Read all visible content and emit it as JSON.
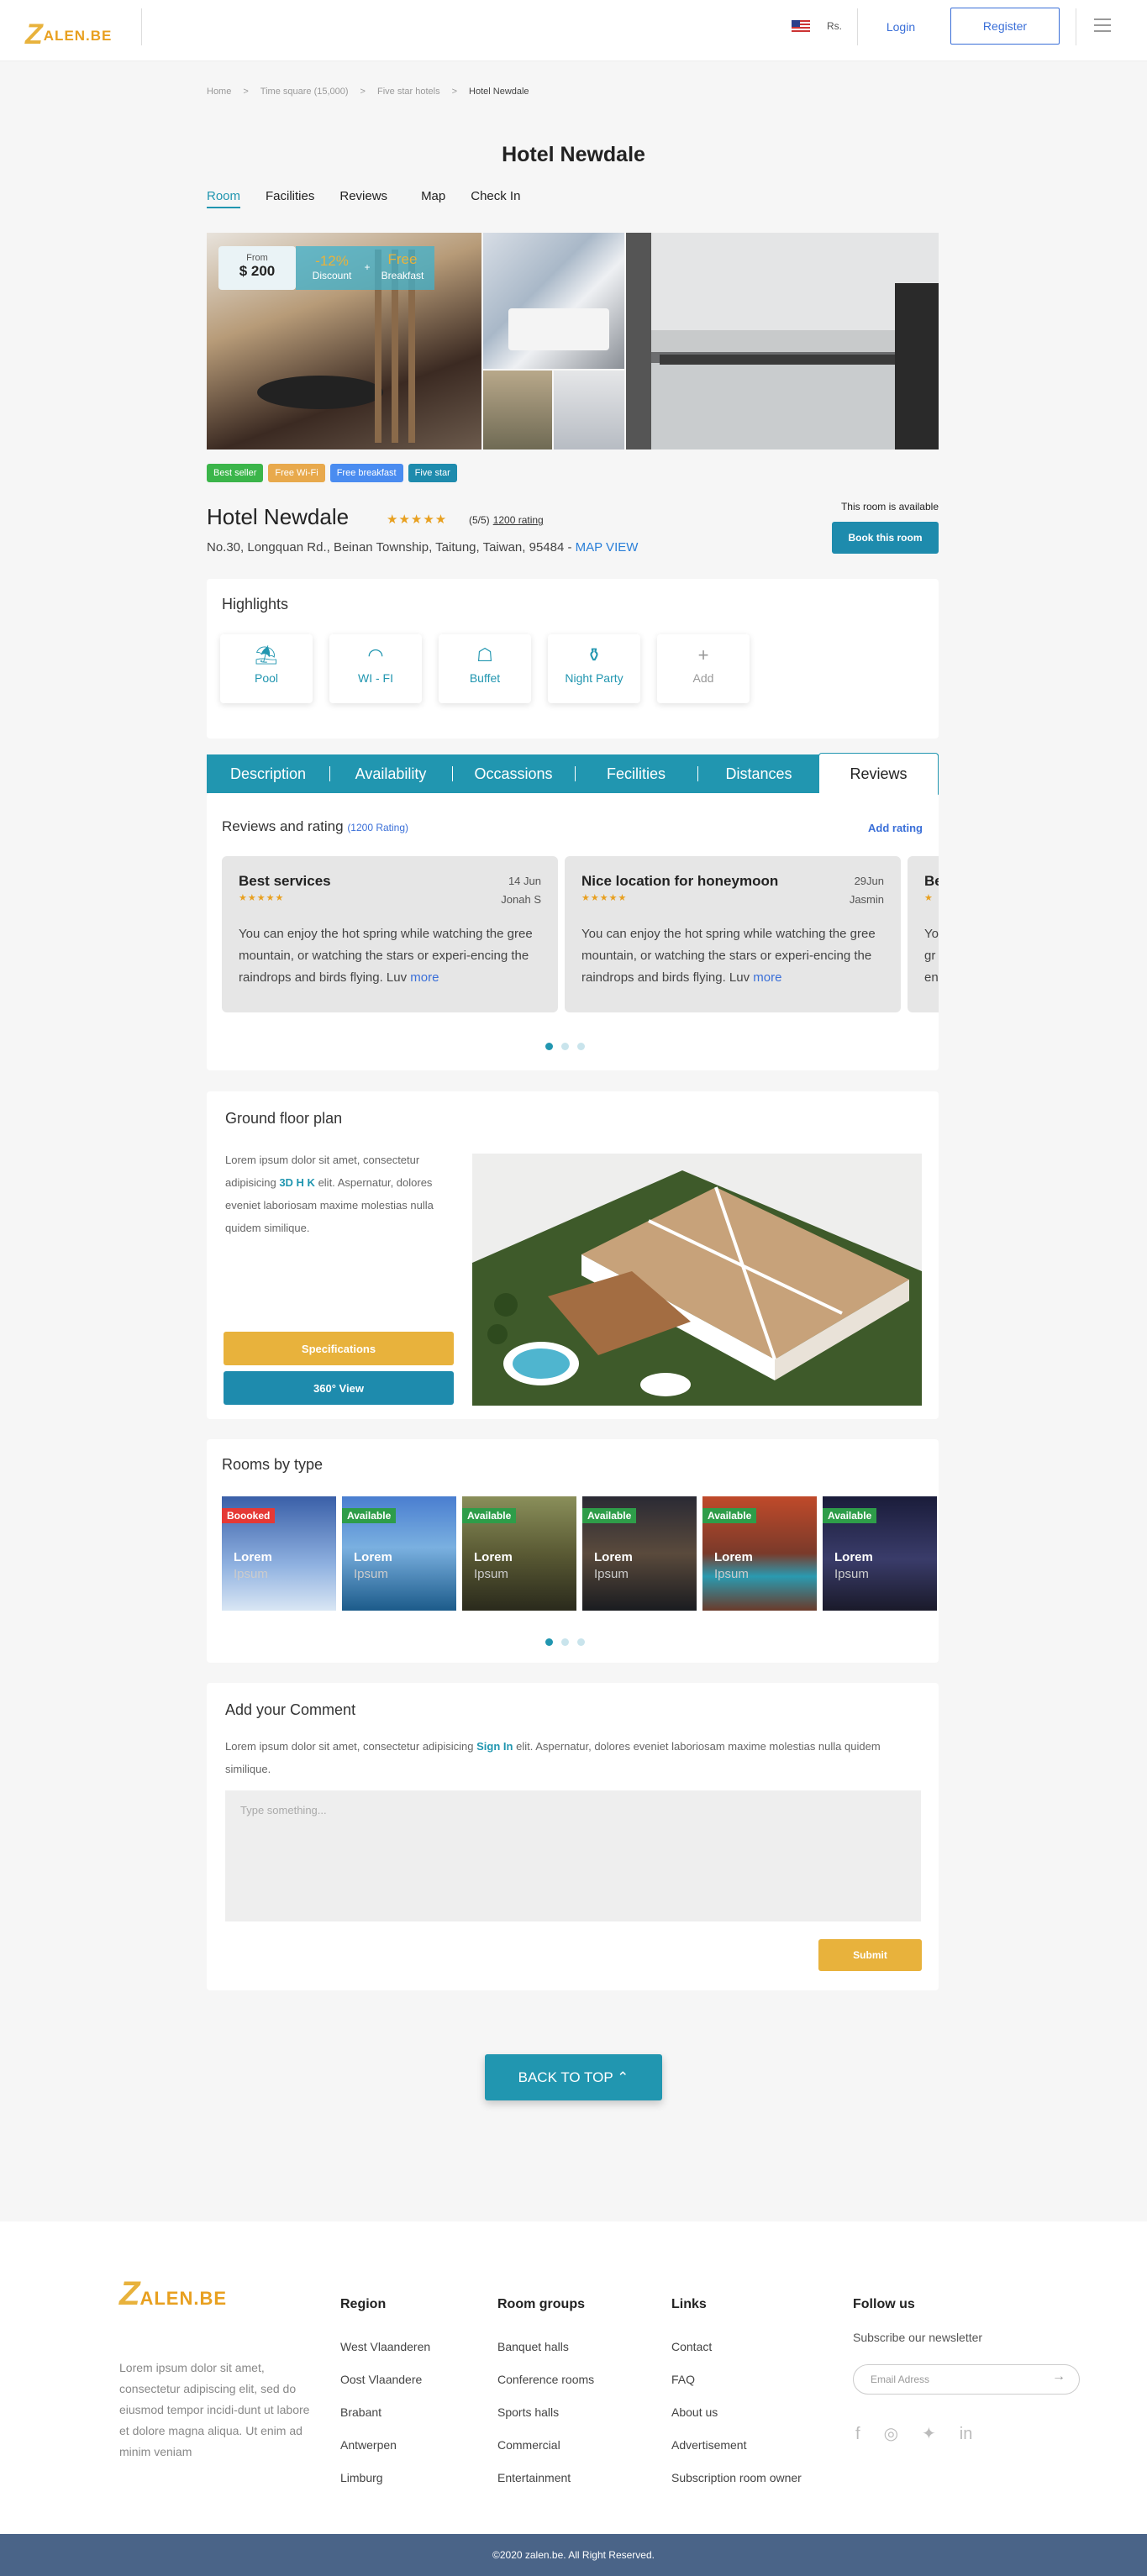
{
  "header": {
    "logo_mark": "Z",
    "logo_text": "ALEN.BE",
    "currency": "Rs.",
    "login": "Login",
    "register": "Register"
  },
  "breadcrumb": [
    "Home",
    ">",
    "Time square (15,000)",
    ">",
    "Five star hotels",
    ">",
    "Hotel Newdale"
  ],
  "title": "Hotel Newdale",
  "tabs": [
    "Room",
    "Facilities",
    "Reviews",
    "Map",
    "Check In"
  ],
  "gallery": {
    "from": "From",
    "price": "$ 200",
    "discount_pct": "-12%",
    "discount": "Discount",
    "plus": "+",
    "free": "Free",
    "breakfast": "Breakfast"
  },
  "badges": [
    {
      "label": "Best seller",
      "color": "#3bb54a"
    },
    {
      "label": "Free Wi-Fi",
      "color": "#e8a94c"
    },
    {
      "label": "Free breakfast",
      "color": "#4a8cf0"
    },
    {
      "label": "Five star",
      "color": "#1e8bad"
    }
  ],
  "hotel": {
    "name": "Hotel Newdale",
    "stars": "★★★★★",
    "rating": "(5/5)",
    "rating_count": "1200 rating",
    "address": "No.30, Longquan Rd., Beinan Township, Taitung, Taiwan, 95484 - ",
    "map_view": "MAP VIEW",
    "available": "This room is available",
    "book": "Book this room"
  },
  "highlights": {
    "title": "Highlights",
    "items": [
      {
        "icon": "pool-icon",
        "glyph": "⛱",
        "label": "Pool"
      },
      {
        "icon": "wifi-icon",
        "glyph": "◠",
        "label": "WI - FI"
      },
      {
        "icon": "buffet-icon",
        "glyph": "☖",
        "label": "Buffet"
      },
      {
        "icon": "night-party-icon",
        "glyph": "⚱",
        "label": "Night Party"
      },
      {
        "icon": "add-icon",
        "glyph": "+",
        "label": "Add"
      }
    ]
  },
  "desc_tabs": [
    "Description",
    "Availability",
    "Occassions",
    "Fecilities",
    "Distances",
    "Reviews"
  ],
  "reviews": {
    "title": "Reviews and rating",
    "count": "(1200 Rating)",
    "add": "Add rating",
    "cards": [
      {
        "title": "Best services",
        "date": "14 Jun",
        "user": "Jonah S",
        "stars": "★★★★★",
        "body": "You can enjoy the hot spring while watching the gree mountain, or watching the stars or experi-encing the raindrops and birds flying. Luv ",
        "more": "more"
      },
      {
        "title": "Nice location for honeymoon",
        "date": "29Jun",
        "user": "Jasmin",
        "stars": "★★★★★",
        "body": "You can enjoy the hot spring while watching the gree mountain, or watching the stars or experi-encing the raindrops and birds flying. Luv ",
        "more": "more"
      },
      {
        "title": "Be",
        "date": "",
        "user": "",
        "stars": "★",
        "body": "Yo gr en",
        "more": ""
      }
    ]
  },
  "floorplan": {
    "title": "Ground floor plan",
    "text_a": "Lorem ipsum dolor sit amet, consectetur adipisicing ",
    "text_b": "3D H K",
    "text_c": " elit. Asperna­tur, dolores eveniet laboriosam maxime molestias nulla quidem similique.",
    "specs": "Specifications",
    "view": "360° View"
  },
  "rooms": {
    "title": "Rooms by type",
    "items": [
      {
        "tag": "Boooked",
        "tag_color": "#e53935",
        "l1": "Lorem",
        "l2": "Ipsum",
        "bg": "linear-gradient(#3a5fa8,#8fb1e0 60%,#d9e6f4)"
      },
      {
        "tag": "Available",
        "tag_color": "#2e9d49",
        "l1": "Lorem",
        "l2": "Ipsum",
        "bg": "linear-gradient(#4a7ed0,#7ab0e0 45%,#1c5b8a)"
      },
      {
        "tag": "Available",
        "tag_color": "#2e9d49",
        "l1": "Lorem",
        "l2": "Ipsum",
        "bg": "linear-gradient(#8a8f5a,#5a5a34 50%,#2a2a1c)"
      },
      {
        "tag": "Available",
        "tag_color": "#2e9d49",
        "l1": "Lorem",
        "l2": "Ipsum",
        "bg": "linear-gradient(#2a2a34,#5a4a3c 50%,#1a1c20)"
      },
      {
        "tag": "Available",
        "tag_color": "#2e9d49",
        "l1": "Lorem",
        "l2": "Ipsum",
        "bg": "linear-gradient(#c04a2a,#7a3a2a 50%,#2a9ab0 70%,#6a3a2a)"
      },
      {
        "tag": "Available",
        "tag_color": "#2e9d49",
        "l1": "Lorem",
        "l2": "Ipsum",
        "bg": "linear-gradient(#1a1c3a,#3a3c6a 55%,#1a1a2a)"
      }
    ]
  },
  "comment": {
    "title": "Add your Comment",
    "text_a": "Lorem ipsum dolor sit amet, consectetur adipisicing ",
    "sign_in": "Sign In",
    "text_b": " elit. Asperna­tur, dolores eveniet laboriosam maxime molestias nulla quidem similique.",
    "placeholder": "Type something...",
    "submit": "Submit"
  },
  "back_to_top": "BACK TO TOP",
  "footer": {
    "about": "Lorem ipsum dolor sit amet, consectetur adipiscing elit, sed do eiusmod tempor incidi-dunt ut labore et dolore magna aliqua. Ut enim ad minim veniam",
    "region": {
      "title": "Region",
      "items": [
        "West Vlaanderen",
        "Oost Vlaandere",
        "Brabant",
        "Antwerpen",
        "Limburg"
      ]
    },
    "groups": {
      "title": "Room groups",
      "items": [
        "Banquet halls",
        "Conference rooms",
        "Sports halls",
        "Commercial",
        "Entertainment"
      ]
    },
    "links": {
      "title": "Links",
      "items": [
        "Contact",
        "FAQ",
        "About us",
        "Advertisement",
        "Subscription room owner"
      ]
    },
    "follow": {
      "title": "Follow us",
      "subscribe": "Subscribe our newsletter",
      "email_placeholder": "Email Adress"
    },
    "copyright": "©2020 zalen.be. All Right Reserved."
  }
}
